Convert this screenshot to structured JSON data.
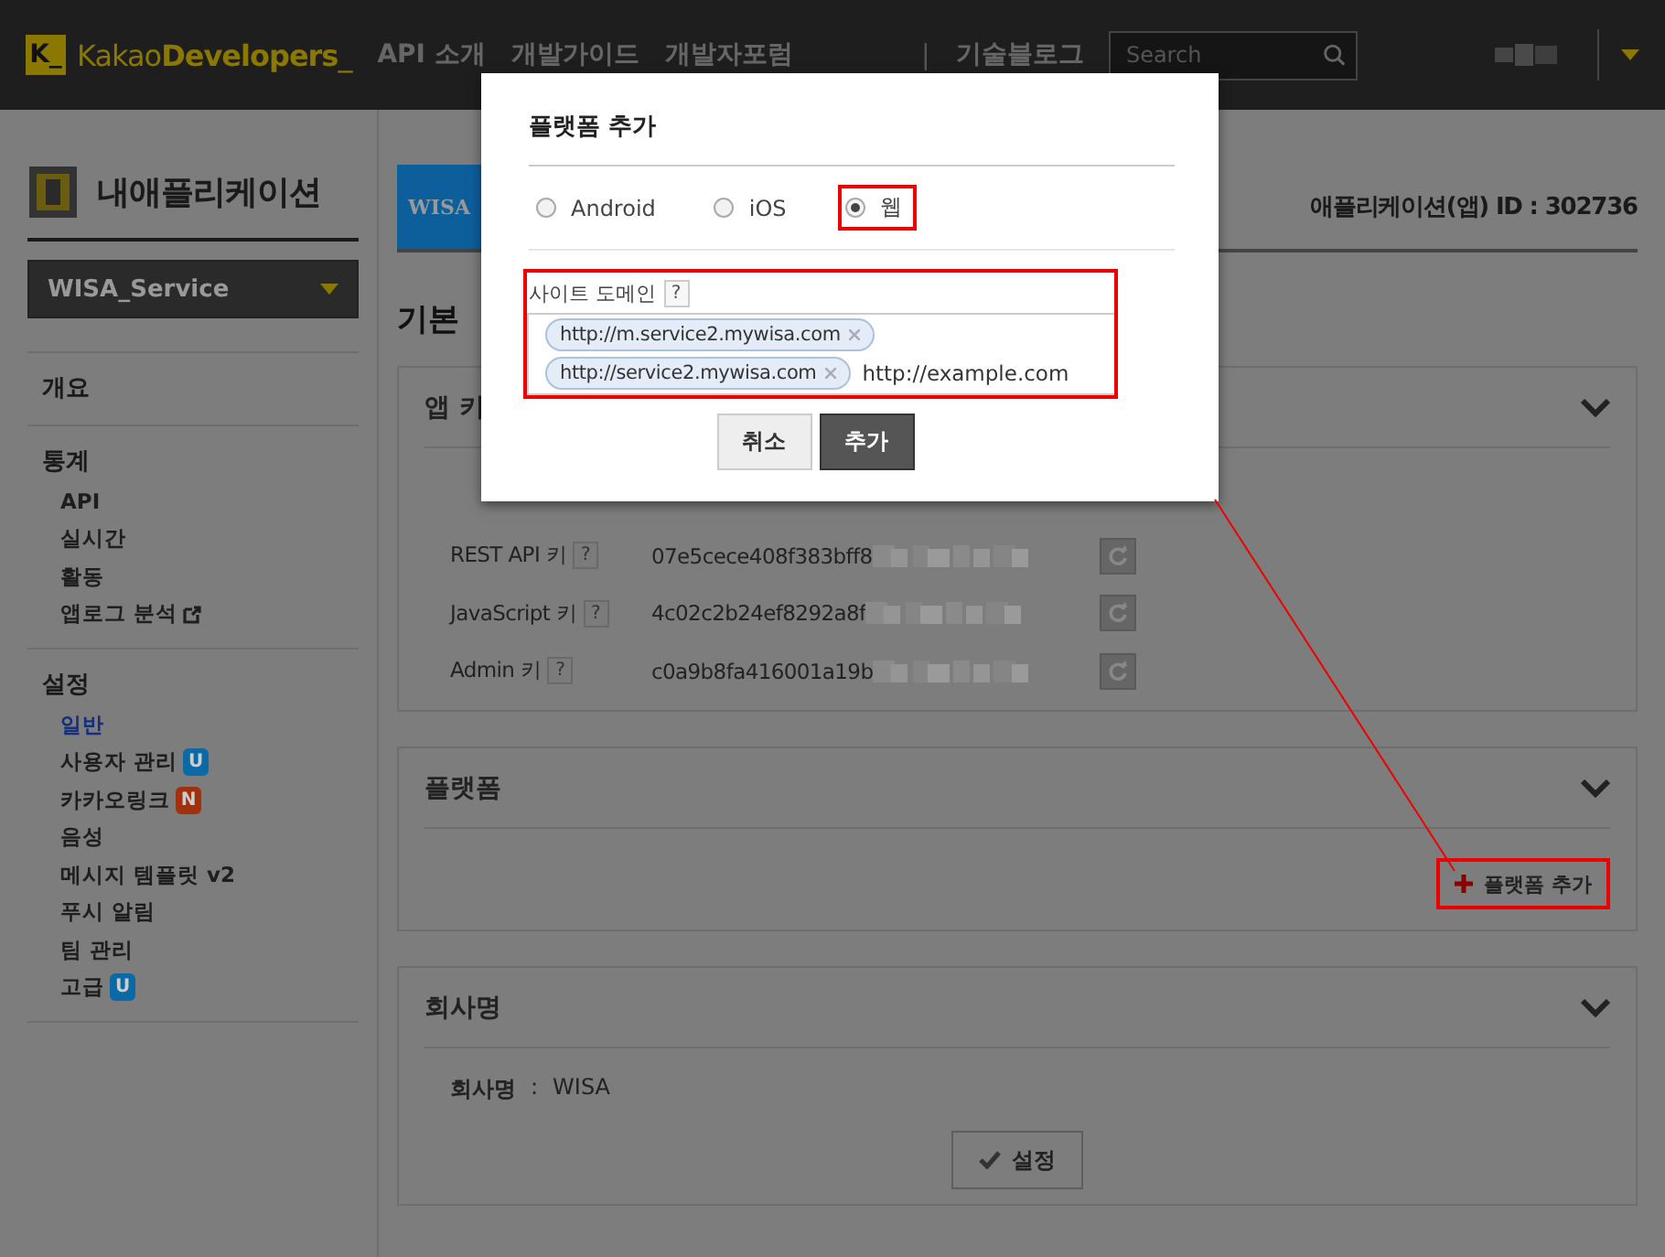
{
  "header": {
    "logo_mark": "K_",
    "logo_text": "Kakao**Developers**_",
    "nav": [
      "API 소개",
      "개발가이드",
      "개발자포럼"
    ],
    "separator": "|",
    "nav_extra": "기술블로그",
    "search": {
      "placeholder": "Search"
    }
  },
  "sidebar": {
    "title": "내애플리케이션",
    "app_select": "WISA_Service",
    "sections": [
      {
        "title": "개요"
      },
      {
        "title": "통계",
        "items": [
          {
            "label": "API",
            "selected": false
          },
          {
            "label": "실시간",
            "selected": false
          },
          {
            "label": "활동",
            "selected": false
          },
          {
            "label": "앱로그 분석",
            "selected": false,
            "external": true
          }
        ]
      },
      {
        "title": "설정",
        "items": [
          {
            "label": "일반",
            "selected": true
          },
          {
            "label": "사용자 관리",
            "selected": false,
            "badge": {
              "text": "U",
              "color": "#0b6aa6"
            }
          },
          {
            "label": "카카오링크",
            "selected": false,
            "badge": {
              "text": "N",
              "color": "#a0300e"
            }
          },
          {
            "label": "음성",
            "selected": false
          },
          {
            "label": "메시지 템플릿 v2",
            "selected": false
          },
          {
            "label": "푸시 알림",
            "selected": false
          },
          {
            "label": "팀 관리",
            "selected": false
          },
          {
            "label": "고급",
            "selected": false,
            "badge": {
              "text": "U",
              "color": "#0b6aa6"
            }
          }
        ]
      }
    ]
  },
  "app": {
    "logo": "WISA",
    "app_id": "애플리케이션(앱) ID : 302736"
  },
  "section_title": "기본",
  "app_keys": {
    "title": "앱 키",
    "rows": [
      {
        "label": "REST API 키",
        "help": "?",
        "value": "07e5cece408f383bff8"
      },
      {
        "label": "JavaScript 키",
        "help": "?",
        "value": "4c02c2b24ef8292a8f"
      },
      {
        "label": "Admin 키",
        "help": "?",
        "value": "c0a9b8fa416001a19b"
      }
    ]
  },
  "platform": {
    "title": "플랫폼",
    "add_button": {
      "label": "플랫폼 추가",
      "highlighted": true
    }
  },
  "company": {
    "title": "회사명",
    "label": "회사명",
    "separator": ":",
    "value": "WISA",
    "button": "설정"
  },
  "modal": {
    "title": "플랫폼 추가",
    "platforms": [
      {
        "label": "Android",
        "selected": false,
        "highlighted": false
      },
      {
        "label": "iOS",
        "selected": false,
        "highlighted": false
      },
      {
        "label": "웹",
        "selected": true,
        "highlighted": true
      }
    ],
    "domain": {
      "label": "사이트 도메인",
      "help": "?",
      "highlighted": true,
      "tags": [
        "http://m.service2.mywisa.com",
        "http://service2.mywisa.com"
      ],
      "value": "http://example.com"
    },
    "buttons": [
      {
        "label": "취소",
        "kind": "secondary"
      },
      {
        "label": "추가",
        "kind": "primary"
      }
    ]
  }
}
